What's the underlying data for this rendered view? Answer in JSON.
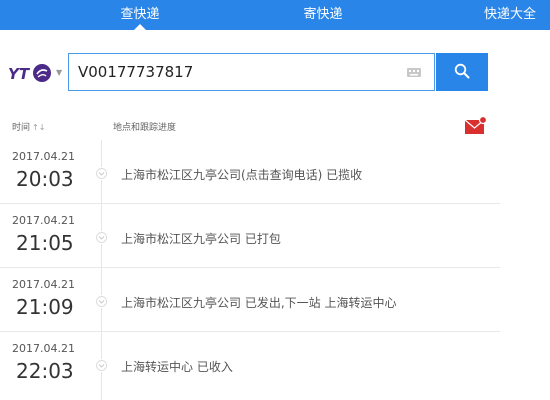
{
  "nav": {
    "tabs": [
      {
        "label": "查快递"
      },
      {
        "label": "寄快递"
      },
      {
        "label": "快递大全"
      }
    ]
  },
  "search": {
    "carrier_logo": "YTO",
    "value": "V00177737817"
  },
  "list_header": {
    "time": "时间",
    "location": "地点和跟踪进度"
  },
  "records": [
    {
      "date": "2017.04.21",
      "time": "20:03",
      "desc": "上海市松江区九亭公司(点击查询电话) 已揽收"
    },
    {
      "date": "2017.04.21",
      "time": "21:05",
      "desc": "上海市松江区九亭公司 已打包"
    },
    {
      "date": "2017.04.21",
      "time": "21:09",
      "desc": "上海市松江区九亭公司 已发出,下一站 上海转运中心"
    },
    {
      "date": "2017.04.21",
      "time": "22:03",
      "desc": "上海转运中心 已收入"
    }
  ],
  "colors": {
    "brand_blue": "#2a85e8",
    "logo_purple": "#4b2b87",
    "mail_red": "#d9302f"
  }
}
